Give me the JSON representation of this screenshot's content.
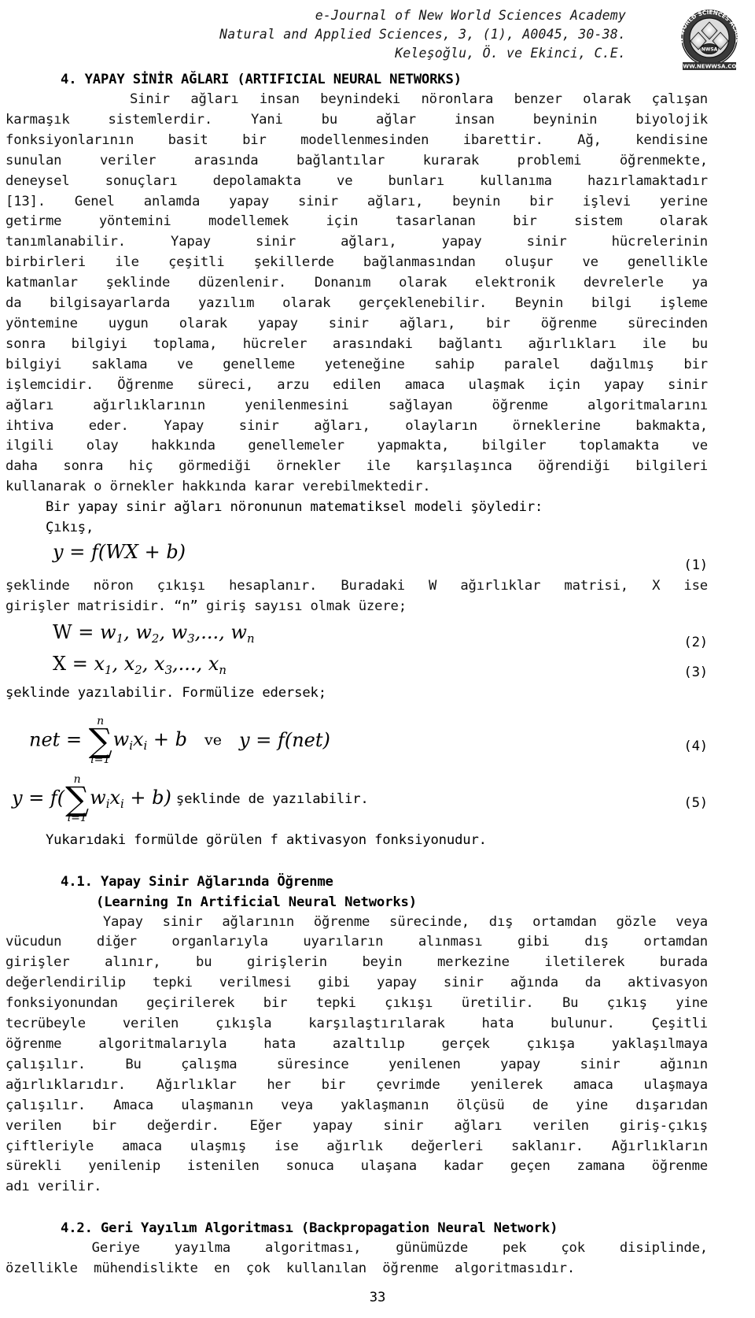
{
  "header": {
    "line1": "e-Journal of New World Sciences Academy",
    "line2": "Natural and Applied Sciences, 3, (1), A0045, 30-38.",
    "line3": "Keleşoğlu, Ö. ve Ekinci, C.E.",
    "logo": {
      "outer_text": "NEW WORLD SCIENCES ACADEMY",
      "center_text": "NWSA",
      "bottom_text": "WWW.NEWWSA.COM"
    }
  },
  "sections": {
    "s4_heading": "4. YAPAY SİNİR AĞLARI (ARTIFICIAL NEURAL NETWORKS)",
    "s41_heading_tr": "4.1. Yapay Sinir Ağlarında Öğrenme",
    "s41_heading_en": "(Learning In Artificial Neural Networks)",
    "s42_heading": "4.2. Geri Yayılım Algoritması (Backpropagation Neural Network)"
  },
  "paragraph1": [
    "      Sinir ağları insan beynindeki nöronlara benzer olarak çalışan",
    "karmaşık  sistemlerdir.  Yani  bu  ağlar  insan  beyninin  biyolojik",
    "fonksiyonlarının  basit  bir  modellenmesinden  ibarettir.  Ağ,  kendisine",
    "sunulan  veriler  arasında  bağlantılar  kurarak  problemi  öğrenmekte,",
    "deneysel  sonuçları  depolamakta  ve  bunları  kullanıma  hazırlamaktadır",
    "[13].  Genel  anlamda  yapay  sinir  ağları,  beynin  bir  işlevi  yerine",
    "getirme  yöntemini  modellemek  için  tasarlanan  bir  sistem  olarak",
    "tanımlanabilir.  Yapay  sinir  ağları,  yapay  sinir  hücrelerinin",
    "birbirleri  ile  çeşitli  şekillerde  bağlanmasından  oluşur  ve  genellikle",
    "katmanlar  şeklinde  düzenlenir.  Donanım  olarak  elektronik  devrelerle  ya",
    "da  bilgisayarlarda  yazılım  olarak  gerçeklenebilir.  Beynin  bilgi  işleme",
    "yöntemine  uygun  olarak  yapay  sinir  ağları,  bir  öğrenme  sürecinden",
    "sonra  bilgiyi  toplama,  hücreler  arasındaki  bağlantı  ağırlıkları  ile  bu",
    "bilgiyi  saklama  ve  genelleme  yeteneğine  sahip  paralel  dağılmış  bir",
    "işlemcidir.  Öğrenme  süreci,  arzu  edilen  amaca  ulaşmak  için  yapay  sinir",
    "ağları  ağırlıklarının  yenilenmesini  sağlayan  öğrenme  algoritmalarını",
    "ihtiva  eder.  Yapay  sinir  ağları,  olayların  örneklerine  bakmakta,",
    "ilgili  olay  hakkında  genellemeler  yapmakta,  bilgiler  toplamakta  ve",
    "daha  sonra  hiç  görmediği  örnekler  ile  karşılaşınca  öğrendiği  bilgileri",
    "kullanarak o örnekler hakkında karar verebilmektedir."
  ],
  "lead_in_lines": {
    "l1": "     Bir yapay sinir ağları nöronunun matematiksel modeli şöyledir:",
    "l2": "     Çıkış,"
  },
  "paragraph2": [
    "şeklinde nöron çıkışı hesaplanır. Buradaki W ağırlıklar matrisi, X ise",
    "girişler matrisidir. “n” giriş sayısı olmak üzere;"
  ],
  "paragraph3": [
    "şeklinde yazılabilir. Formülize edersek;"
  ],
  "after_eq5": "     Yukarıdaki formülde görülen f aktivasyon fonksiyonudur.",
  "equations": {
    "eq1": {
      "lhs": "y",
      "eq": " = ",
      "f": "f",
      "expr": "(WX + b)",
      "number": "(1)"
    },
    "eq2": {
      "text": "W = w1, w2, w3,..., wn",
      "number": "(2)"
    },
    "eq3": {
      "text": "X = x1, x2, x3,..., xn",
      "number": "(3)"
    },
    "eq4": {
      "lhs": "net",
      "sum_top": "n",
      "sum_bot": "i=1",
      "summand": "wixi + b",
      "conj": "ve",
      "rhs": "y = f(net)",
      "number": "(4)"
    },
    "eq5": {
      "lhs": "y = f(",
      "sum_top": "n",
      "sum_bot": "i=1",
      "summand": "wixi + b)",
      "tail": "şeklinde de yazılabilir.",
      "number": "(5)"
    }
  },
  "paragraph4": [
    "     Yapay sinir ağlarının öğrenme sürecinde, dış ortamdan gözle veya",
    "vücudun  diğer  organlarıyla  uyarıların  alınması  gibi  dış  ortamdan",
    "girişler  alınır,  bu  girişlerin  beyin  merkezine  iletilerek  burada",
    "değerlendirilip  tepki  verilmesi  gibi  yapay  sinir  ağında  da  aktivasyon",
    "fonksiyonundan  geçirilerek  bir  tepki  çıkışı  üretilir.  Bu  çıkış  yine",
    "tecrübeyle  verilen  çıkışla  karşılaştırılarak  hata  bulunur.  Çeşitli",
    "öğrenme  algoritmalarıyla  hata  azaltılıp  gerçek  çıkışa  yaklaşılmaya",
    "çalışılır.  Bu  çalışma  süresince  yenilenen  yapay  sinir  ağının",
    "ağırlıklarıdır. Ağırlıklar her bir çevrimde yenilerek amaca ulaşmaya",
    "çalışılır. Amaca ulaşmanın veya yaklaşmanın ölçüsü de yine dışarıdan",
    "verilen bir değerdir. Eğer yapay sinir ağları verilen giriş-çıkış",
    "çiftleriyle amaca ulaşmış ise ağırlık değerleri saklanır. Ağırlıkların",
    "sürekli yenilenip istenilen sonuca ulaşana kadar geçen zamana öğrenme",
    "adı verilir."
  ],
  "paragraph5": [
    "     Geriye  yayılma  algoritması,  günümüzde  pek  çok  disiplinde,",
    "özellikle  mühendislikte  en  çok  kullanılan  öğrenme  algoritmasıdır."
  ],
  "page_number": "33"
}
